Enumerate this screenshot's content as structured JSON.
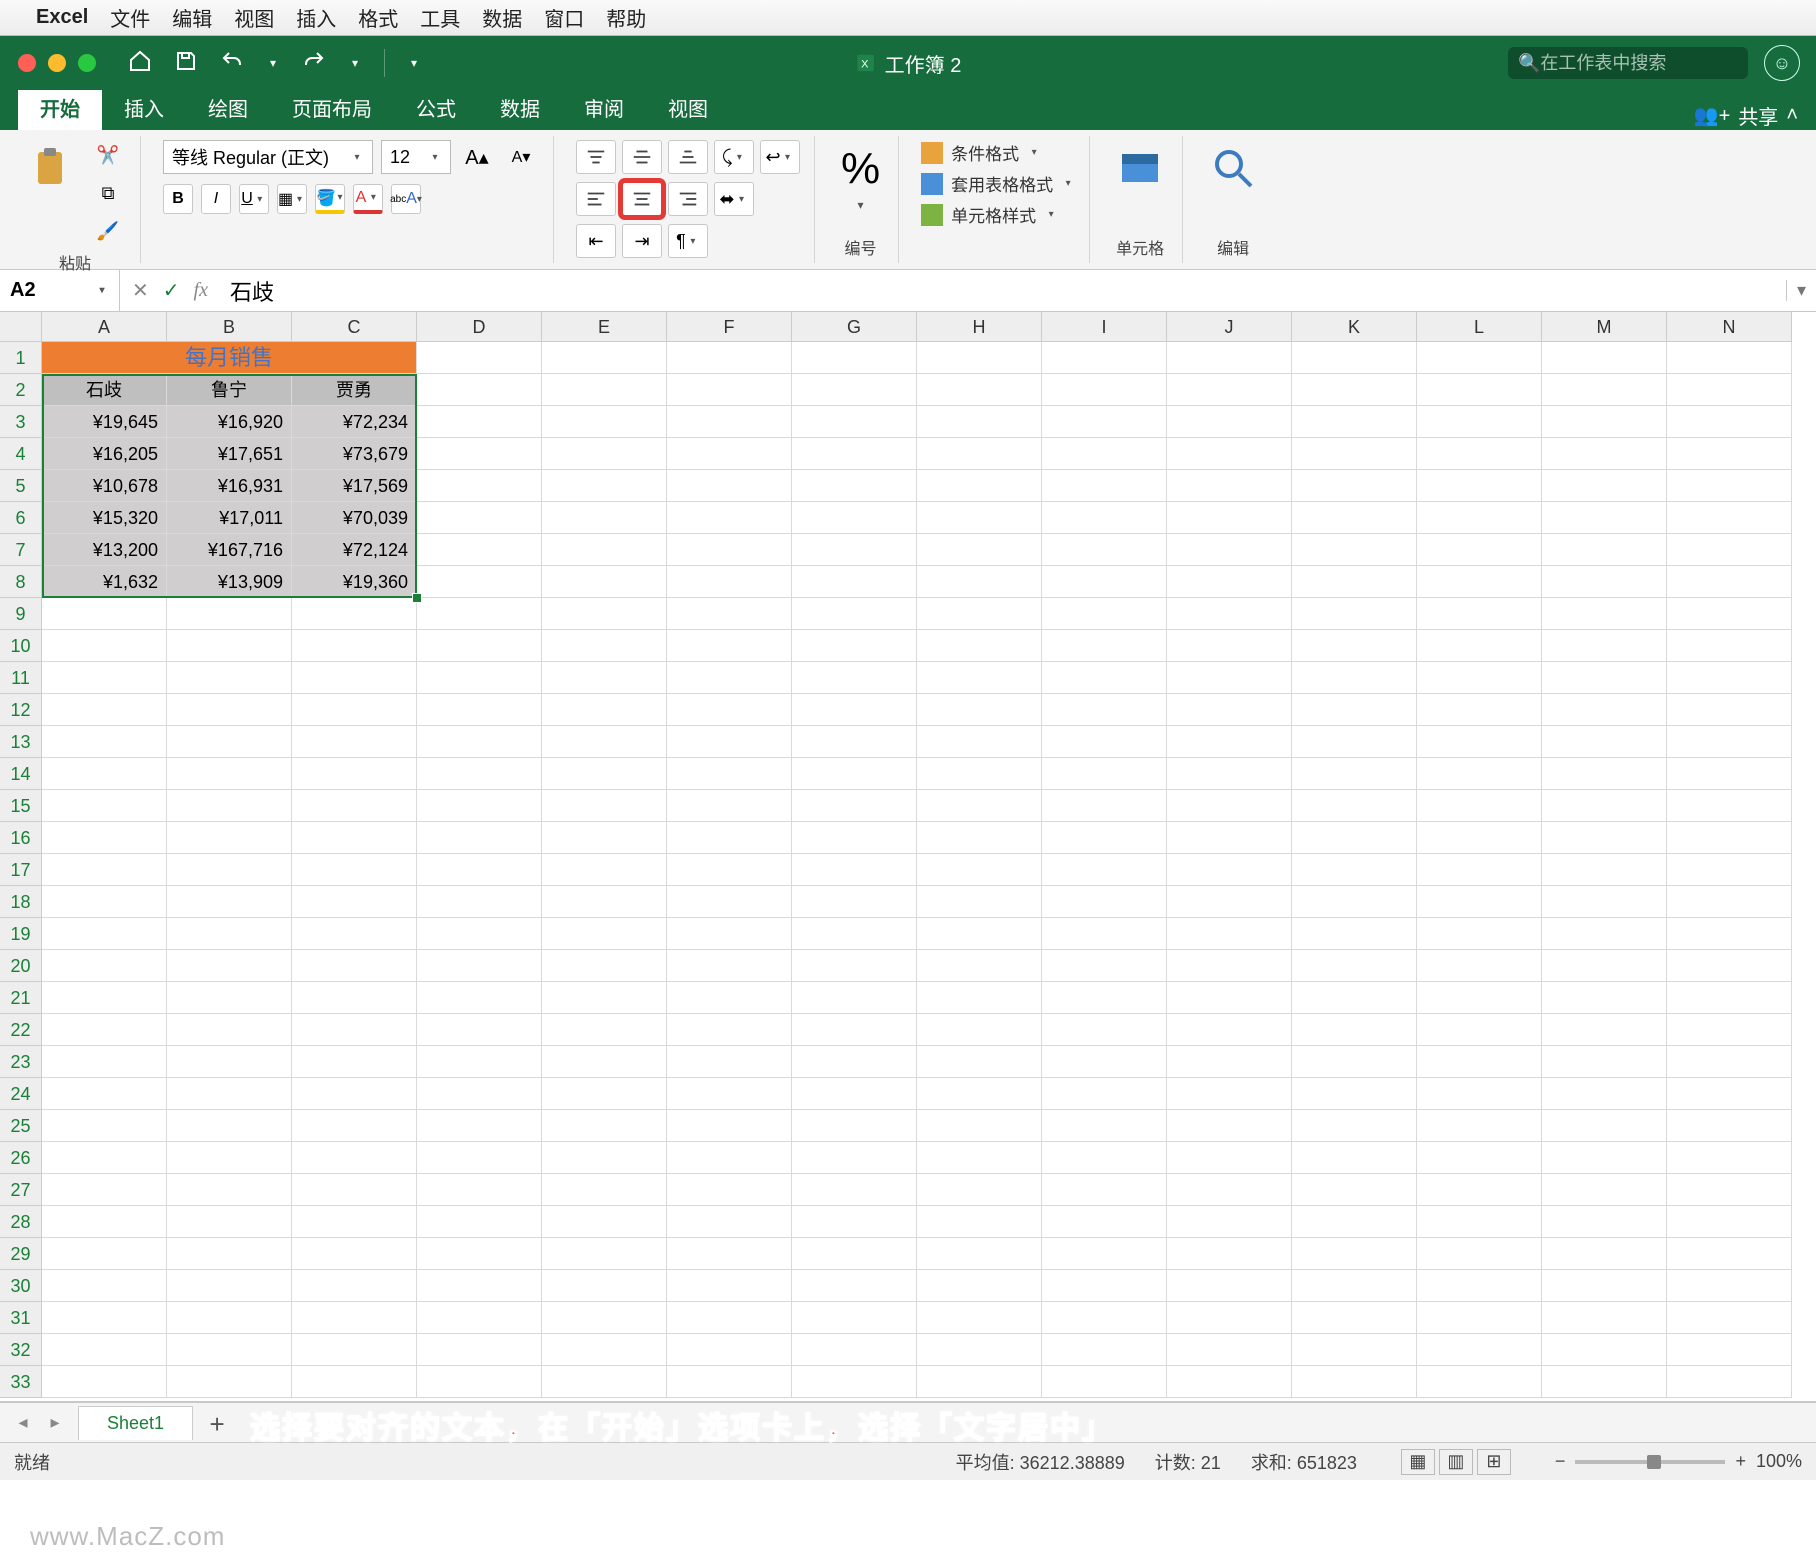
{
  "mac_menu": {
    "app": "Excel",
    "items": [
      "文件",
      "编辑",
      "视图",
      "插入",
      "格式",
      "工具",
      "数据",
      "窗口",
      "帮助"
    ]
  },
  "window_title": "工作簿 2",
  "search_placeholder": "在工作表中搜索",
  "ribbon_tabs": [
    "开始",
    "插入",
    "绘图",
    "页面布局",
    "公式",
    "数据",
    "审阅",
    "视图"
  ],
  "share_label": "共享",
  "groups": {
    "paste": "粘贴",
    "number": "编号",
    "cells": "单元格",
    "edit": "编辑",
    "conditional": "条件格式",
    "table_format": "套用表格格式",
    "cell_styles": "单元格样式"
  },
  "font": {
    "name": "等线 Regular (正文)",
    "size": "12"
  },
  "namebox": "A2",
  "formula": "石歧",
  "columns": [
    "A",
    "B",
    "C",
    "D",
    "E",
    "F",
    "G",
    "H",
    "I",
    "J",
    "K",
    "L",
    "M",
    "N"
  ],
  "row_count": 33,
  "spreadsheet": {
    "title": "每月销售",
    "headers": [
      "石歧",
      "鲁宁",
      "贾勇"
    ],
    "rows": [
      [
        "¥19,645",
        "¥16,920",
        "¥72,234"
      ],
      [
        "¥16,205",
        "¥17,651",
        "¥73,679"
      ],
      [
        "¥10,678",
        "¥16,931",
        "¥17,569"
      ],
      [
        "¥15,320",
        "¥17,011",
        "¥70,039"
      ],
      [
        "¥13,200",
        "¥167,716",
        "¥72,124"
      ],
      [
        "¥1,632",
        "¥13,909",
        "¥19,360"
      ]
    ]
  },
  "sheet_tab": "Sheet1",
  "callout": "选择要对齐的文本，在「开始」选项卡上，选择「文字居中」",
  "status": {
    "ready": "就绪",
    "avg_label": "平均值:",
    "avg": "36212.38889",
    "count_label": "计数:",
    "count": "21",
    "sum_label": "求和:",
    "sum": "651823",
    "zoom": "100%"
  },
  "watermark": "www.MacZ.com"
}
